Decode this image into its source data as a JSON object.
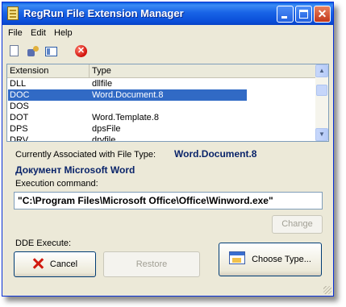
{
  "window": {
    "title": "RegRun File Extension Manager"
  },
  "menu": {
    "items": [
      "File",
      "Edit",
      "Help"
    ]
  },
  "toolbar": {
    "icons": [
      "new-document-icon",
      "properties-icon",
      "view-icon",
      "delete-icon"
    ]
  },
  "list": {
    "columns": [
      "Extension",
      "Type"
    ],
    "rows": [
      {
        "ext": "DLL",
        "type": "dllfile",
        "selected": false
      },
      {
        "ext": "DOC",
        "type": "Word.Document.8",
        "selected": true
      },
      {
        "ext": "DOS",
        "type": "",
        "selected": false
      },
      {
        "ext": "DOT",
        "type": "Word.Template.8",
        "selected": false
      },
      {
        "ext": "DPS",
        "type": "dpsFile",
        "selected": false
      },
      {
        "ext": "DRV",
        "type": "drvfile",
        "selected": false
      }
    ]
  },
  "details": {
    "associated_label": "Currently Associated with File Type:",
    "associated_value": "Word.Document.8",
    "description": "Документ Microsoft Word",
    "execution_label": "Execution command:",
    "command": "\"C:\\Program Files\\Microsoft Office\\Office\\Winword.exe\""
  },
  "buttons": {
    "change": "Change",
    "dde_label": "DDE Execute:",
    "cancel": "Cancel",
    "restore": "Restore",
    "choose": "Choose Type..."
  },
  "colors": {
    "selection": "#316ac5",
    "accent_text": "#0a246a",
    "titlebar": "#0a4ed8"
  }
}
